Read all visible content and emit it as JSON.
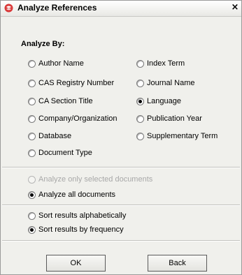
{
  "window": {
    "title": "Analyze References",
    "close_label": "×",
    "icons": {
      "logo": "cas-logo-icon",
      "close": "close-icon"
    }
  },
  "analyze_by": {
    "heading": "Analyze By:",
    "selected": "Language",
    "options": [
      "Author Name",
      "CAS Registry Number",
      "CA Section Title",
      "Company/Organization",
      "Database",
      "Document Type",
      "Index Term",
      "Journal Name",
      "Language",
      "Publication Year",
      "Supplementary Term"
    ]
  },
  "scope": {
    "selected_docs_label": "Analyze only selected documents",
    "selected_docs_enabled": false,
    "all_docs_label": "Analyze all documents",
    "selected": "Analyze all documents"
  },
  "sort": {
    "alpha_label": "Sort results alphabetically",
    "freq_label": "Sort results by frequency",
    "selected": "Sort results by frequency"
  },
  "buttons": {
    "ok_label": "OK",
    "back_label": "Back"
  }
}
